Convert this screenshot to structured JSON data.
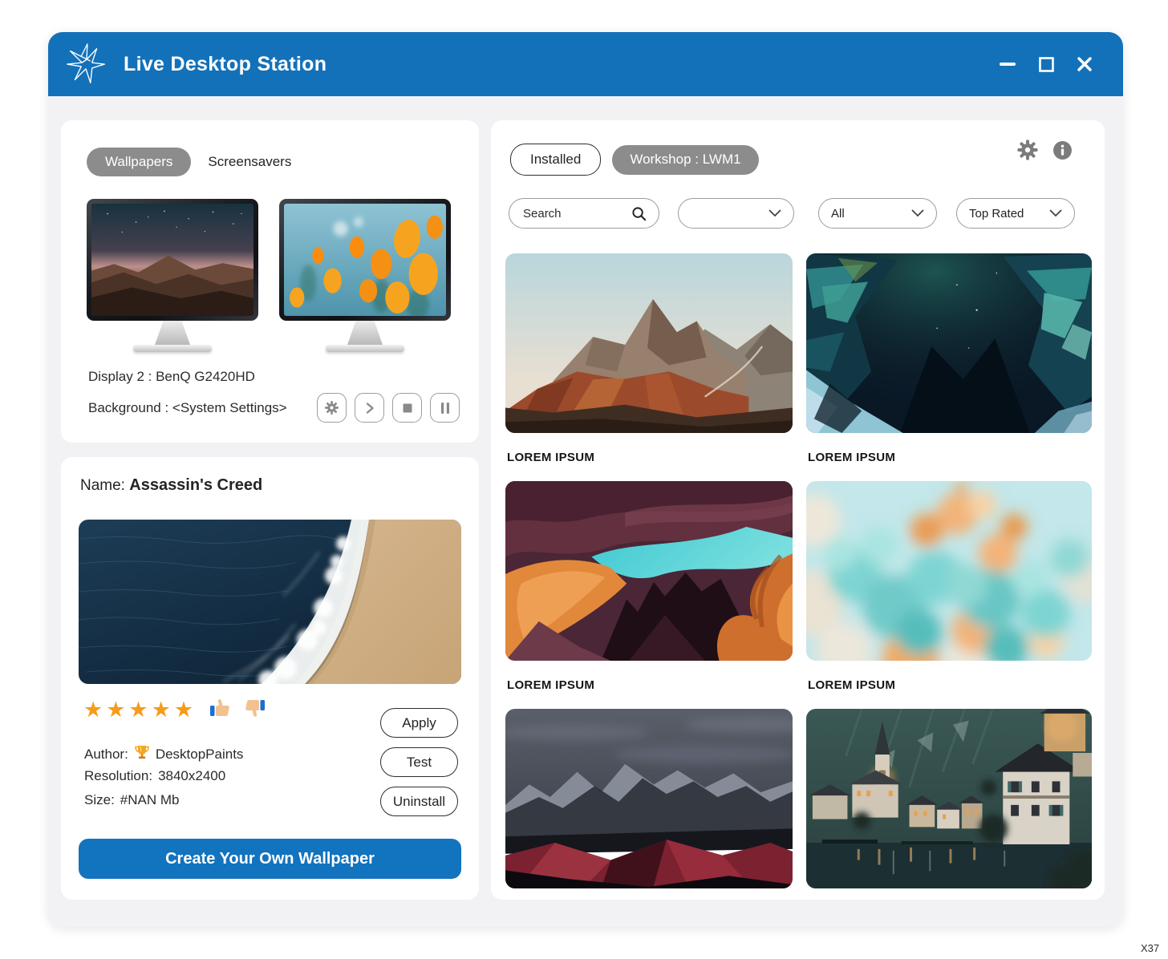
{
  "titlebar": {
    "title": "Live Desktop Station"
  },
  "monitors_panel": {
    "tab_wallpapers": "Wallpapers",
    "tab_screensavers": "Screensavers",
    "display_info": "Display 2 : BenQ G2420HD",
    "background_info": "Background : <System Settings>"
  },
  "details_panel": {
    "name_label": "Name:",
    "name_value": "Assassin's Creed",
    "stars": "★★★★★",
    "author_label": "Author:",
    "author_value": "DesktopPaints",
    "resolution_label": "Resolution:",
    "resolution_value": "3840x2400",
    "size_label": "Size:",
    "size_value": "#NAN Mb",
    "apply_label": "Apply",
    "test_label": "Test",
    "uninstall_label": "Uninstall",
    "cta_label": "Create Your Own Wallpaper"
  },
  "workshop_panel": {
    "installed_label": "Installed",
    "workshop_label": "Workshop : LWM1",
    "search_placeholder": "Search",
    "filter_category_selected": "",
    "filter_all_selected": "All",
    "filter_sort_selected": "Top Rated",
    "items": [
      {
        "title": "LOREM IPSUM",
        "image": "mountain-sunset"
      },
      {
        "title": "LOREM IPSUM",
        "image": "ice-canyon"
      },
      {
        "title": "LOREM IPSUM",
        "image": "antelope-canyon"
      },
      {
        "title": "LOREM IPSUM",
        "image": "ink-in-water"
      },
      {
        "image": "crimson-mountains"
      },
      {
        "image": "hallstatt-village"
      }
    ]
  },
  "annotation": "X37",
  "colors": {
    "titlebar_blue": "#1371B9",
    "accent_blue": "#1273BE",
    "pill_gray": "#8C8C8C",
    "star_orange": "#F59C1B",
    "panel_bg": "#FFFFFF",
    "window_bg": "#F2F2F5"
  }
}
